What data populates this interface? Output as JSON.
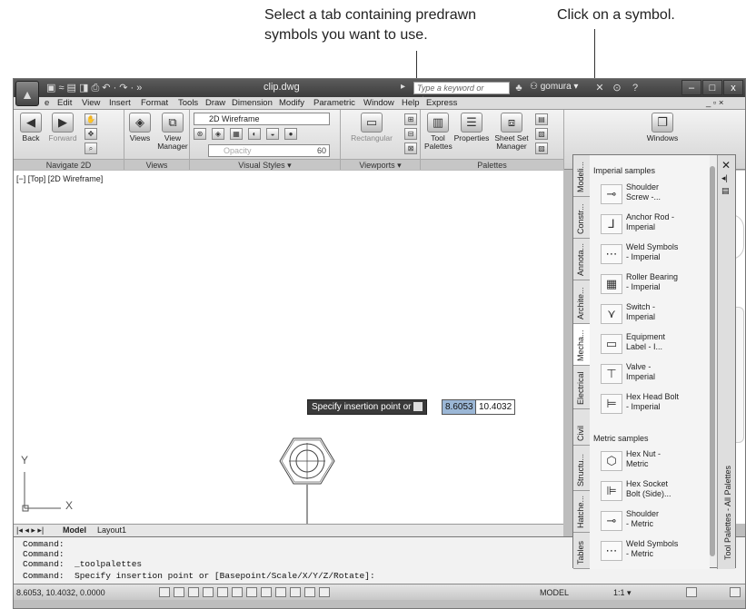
{
  "callouts": {
    "tab": "Select a tab containing predrawn\nsymbols you want to use.",
    "symbol": "Click on a symbol."
  },
  "title_bar": {
    "doc_title": "clip.dwg",
    "search_placeholder": "Type a keyword or phrase",
    "user": "gomura"
  },
  "menu": [
    "e",
    "Edit",
    "View",
    "Insert",
    "Format",
    "Tools",
    "Draw",
    "Dimension",
    "Modify",
    "Parametric",
    "Window",
    "Help",
    "Express"
  ],
  "ribbon": {
    "navigate": {
      "title": "Navigate 2D",
      "back": "Back",
      "forward": "Forward"
    },
    "views": {
      "title": "Views",
      "views": "Views",
      "view_manager": "View\nManager"
    },
    "visual_styles": {
      "title": "Visual Styles ▾",
      "style": "2D Wireframe",
      "opacity": "Opacity",
      "opacity_value": "60"
    },
    "viewports": {
      "title": "Viewports ▾",
      "rectangular": "Rectangular"
    },
    "palettes": {
      "title": "Palettes",
      "tool_palettes": "Tool\nPalettes",
      "properties": "Properties",
      "sheet_set": "Sheet Set\nManager"
    },
    "windows": "Windows"
  },
  "viewport_label": "[−] [Top] [2D Wireframe]",
  "layout_tabs": {
    "model": "Model",
    "layout1": "Layout1"
  },
  "ucs": {
    "x": "X",
    "y": "Y"
  },
  "tooltip": {
    "prompt": "Specify insertion point or",
    "x_value": "8.6053",
    "y_value": "10.4032"
  },
  "command_lines": [
    "Command:",
    "Command:",
    "Command:  _toolpalettes",
    "Command:  Specify insertion point or [Basepoint/Scale/X/Y/Z/Rotate]:"
  ],
  "status": {
    "coords": "8.6053, 10.4032, 0.0000",
    "model": "MODEL",
    "scale": "1:1 ▾"
  },
  "palette": {
    "title": "Tool Palettes - All Palettes",
    "tabs": [
      "Modeli...",
      "Constr...",
      "Annota...",
      "Archite...",
      "Mecha...",
      "Electrical",
      "Civil",
      "Structu...",
      "Hatche...",
      "Tables"
    ],
    "imperial_header": "Imperial samples",
    "metric_header": "Metric samples",
    "imperial_items": [
      {
        "label": "Shoulder\nScrew -...",
        "icon": "screw-icon"
      },
      {
        "label": "Anchor Rod -\nImperial",
        "icon": "anchor-rod-icon"
      },
      {
        "label": "Weld Symbols\n- Imperial",
        "icon": "weld-icon"
      },
      {
        "label": "Roller Bearing\n- Imperial",
        "icon": "bearing-icon"
      },
      {
        "label": "Switch -\nImperial",
        "icon": "switch-icon"
      },
      {
        "label": "Equipment\nLabel - I...",
        "icon": "label-icon"
      },
      {
        "label": "Valve -\nImperial",
        "icon": "valve-icon"
      },
      {
        "label": "Hex Head Bolt\n- Imperial",
        "icon": "bolt-icon"
      }
    ],
    "metric_items": [
      {
        "label": "Hex Nut -\nMetric",
        "icon": "hex-nut-icon"
      },
      {
        "label": "Hex Socket\nBolt (Side)...",
        "icon": "socket-bolt-icon"
      },
      {
        "label": "Shoulder\n- Metric",
        "icon": "screw-icon"
      },
      {
        "label": "Weld Symbols\n- Metric",
        "icon": "weld-icon"
      }
    ]
  }
}
